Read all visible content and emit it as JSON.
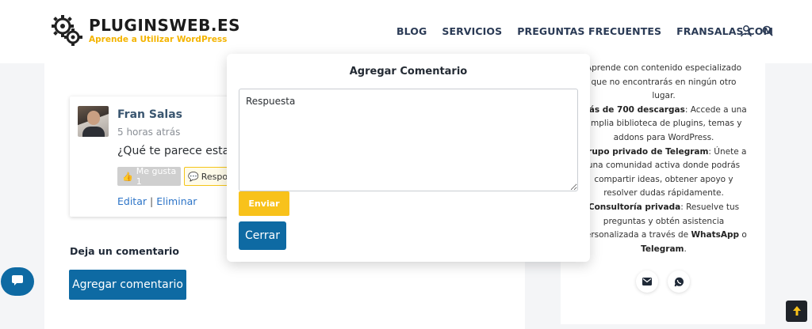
{
  "header": {
    "logo_title": "PLUGINSWEB.ES",
    "logo_subtitle": "Aprende a Utilizar WordPress",
    "nav": [
      "BLOG",
      "SERVICIOS",
      "PREGUNTAS FRECUENTES",
      "FRANSALAS.COM"
    ],
    "icons": [
      "user-icon",
      "search-icon"
    ]
  },
  "comment": {
    "author": "Fran Salas",
    "time": "5 horas atrás",
    "text": "¿Qué te parece esta me",
    "like_label": "Me gusta 1",
    "reply_label": "Respor",
    "edit_label": "Editar",
    "separator": "|",
    "delete_label": "Eliminar"
  },
  "leave_comment": {
    "title": "Deja un comentario",
    "button": "Agregar comentario"
  },
  "sidebar": {
    "line1": "Aprende con contenido especializado que no encontrarás en ningún otro lugar.",
    "item2_title": "Más de 700 descargas",
    "item2_text": ": Accede a una amplia biblioteca de plugins, temas y addons para WordPress.",
    "item3_title": "Grupo privado de Telegram",
    "item3_text": ": Únete a una comunidad activa donde podrás compartir ideas, obtener apoyo y resolver dudas rápidamente.",
    "item4_title": "Consultoría privada",
    "item4_text": ": Resuelve tus preguntas y obtén asistencia personalizada a través de ",
    "item4_whatsapp": "WhatsApp",
    "item4_o": " o ",
    "item4_telegram": "Telegram",
    "item4_end": ".",
    "icons": [
      "mail-icon",
      "whatsapp-icon"
    ]
  },
  "modal": {
    "title": "Agregar Comentario",
    "textarea_value": "Respuesta",
    "send_label": "Enviar",
    "close_label": "Cerrar"
  },
  "colors": {
    "primary": "#0e6aa3",
    "accent": "#f8c21b",
    "nav_text": "#2a3a55"
  }
}
